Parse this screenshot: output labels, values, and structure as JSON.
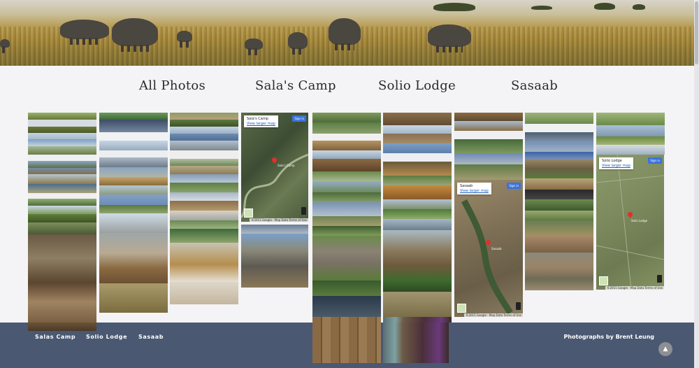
{
  "nav": {
    "items": [
      {
        "label": "All Photos"
      },
      {
        "label": "Sala's Camp"
      },
      {
        "label": "Solio Lodge"
      },
      {
        "label": "Sasaab"
      }
    ]
  },
  "maps": [
    {
      "title": "Sala's Camp",
      "link": "View larger map",
      "signin": "Sign in",
      "pin_label": "Sala's Camp",
      "attribution": "©2015 Google · Map Data   Terms of Use"
    },
    {
      "title": "Sasaab",
      "link": "View larger map",
      "signin": "Sign in",
      "pin_label": "Sasaab",
      "attribution": "©2015 Google · Map Data   Terms of Use"
    },
    {
      "title": "Solio Lodge",
      "link": "View larger map",
      "signin": "Sign in",
      "pin_label": "Solio Lodge",
      "attribution": "©2015 Google · Map Data   Terms of Use"
    }
  ],
  "footer": {
    "links": [
      {
        "label": "Salas Camp"
      },
      {
        "label": "Solio Lodge"
      },
      {
        "label": "Sasaab"
      }
    ],
    "credit": "Photographs by Brent Leung",
    "to_top_icon": "chevron-up-icon"
  },
  "colors": {
    "footer_bg": "#4a5872",
    "page_bg": "#f4f4f6"
  }
}
